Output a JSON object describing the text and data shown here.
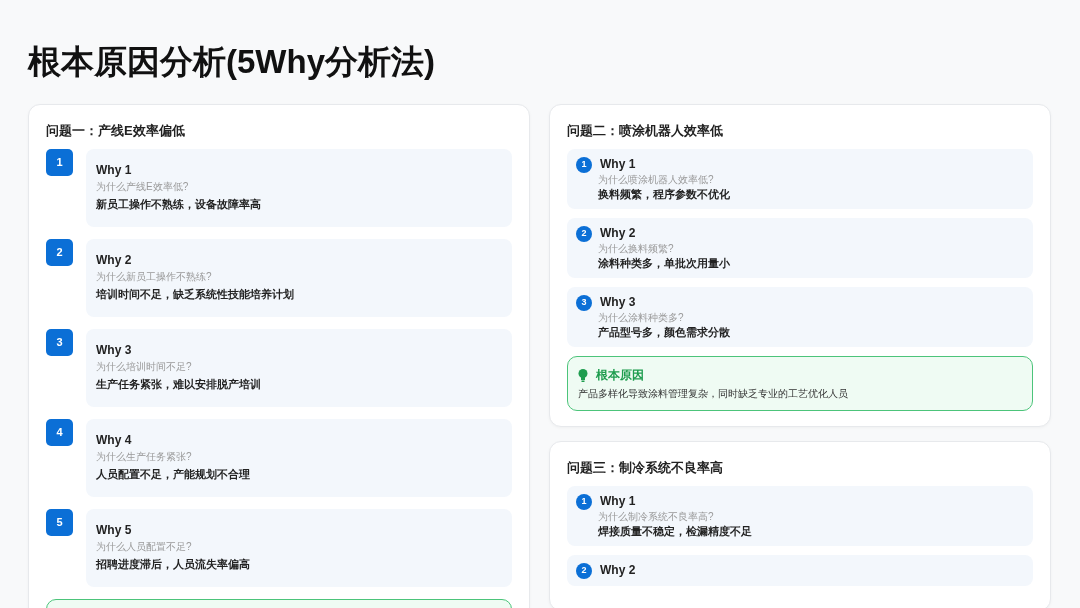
{
  "title": "根本原因分析(5Why分析法)",
  "problems": [
    {
      "title": "问题一：产线E效率偏低",
      "kind": "steps",
      "whys": [
        {
          "number": "1",
          "label": "Why 1",
          "question": "为什么产线E效率低?",
          "answer": "新员工操作不熟练，设备故障率高"
        },
        {
          "number": "2",
          "label": "Why 2",
          "question": "为什么新员工操作不熟练?",
          "answer": "培训时间不足，缺乏系统性技能培养计划"
        },
        {
          "number": "3",
          "label": "Why 3",
          "question": "为什么培训时间不足?",
          "answer": "生产任务紧张，难以安排脱产培训"
        },
        {
          "number": "4",
          "label": "Why 4",
          "question": "为什么生产任务紧张?",
          "answer": "人员配置不足，产能规划不合理"
        },
        {
          "number": "5",
          "label": "Why 5",
          "question": "为什么人员配置不足?",
          "answer": "招聘进度滞后，人员流失率偏高"
        }
      ],
      "root_cause": {
        "kind": "clipped"
      }
    },
    {
      "title": "问题二：喷涂机器人效率低",
      "kind": "compact",
      "whys": [
        {
          "number": "1",
          "label": "Why 1",
          "question": "为什么喷涂机器人效率低?",
          "answer": "换料频繁，程序参数不优化"
        },
        {
          "number": "2",
          "label": "Why 2",
          "question": "为什么换料频繁?",
          "answer": "涂料种类多，单批次用量小"
        },
        {
          "number": "3",
          "label": "Why 3",
          "question": "为什么涂料种类多?",
          "answer": "产品型号多，颜色需求分散"
        }
      ],
      "root_cause": {
        "kind": "full",
        "label": "根本原因",
        "text": "产品多样化导致涂料管理复杂，同时缺乏专业的工艺优化人员"
      }
    },
    {
      "title": "问题三：制冷系统不良率高",
      "kind": "compact",
      "whys": [
        {
          "number": "1",
          "label": "Why 1",
          "question": "为什么制冷系统不良率高?",
          "answer": "焊接质量不稳定，检漏精度不足"
        },
        {
          "number": "2",
          "label": "Why 2"
        }
      ]
    }
  ]
}
